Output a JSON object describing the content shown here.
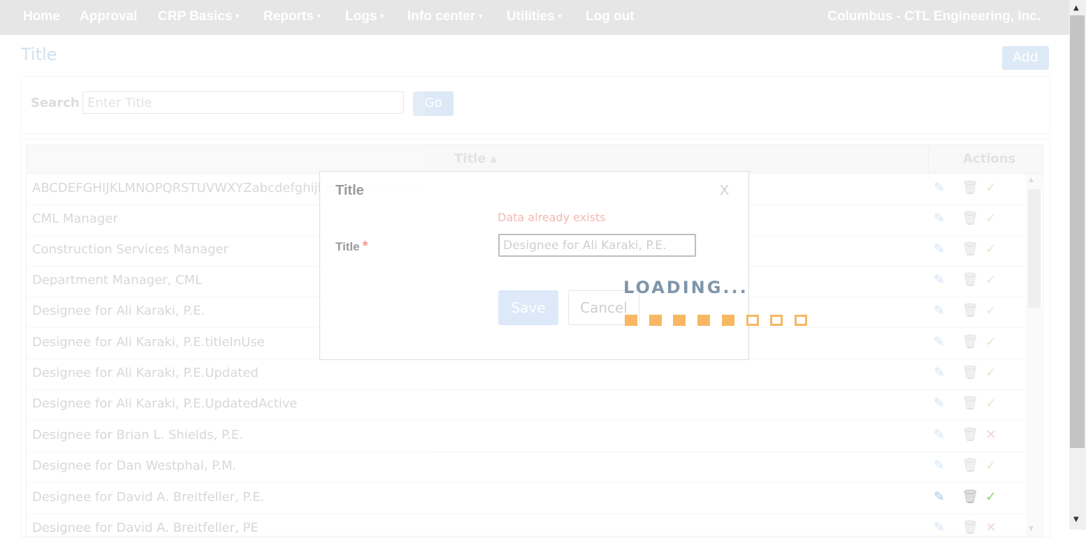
{
  "nav": {
    "items": [
      {
        "label": "Home",
        "dropdown": false
      },
      {
        "label": "Approval",
        "dropdown": false
      },
      {
        "label": "CRP Basics",
        "dropdown": true
      },
      {
        "label": "Reports",
        "dropdown": true
      },
      {
        "label": "Logs",
        "dropdown": true
      },
      {
        "label": "Info center",
        "dropdown": true
      },
      {
        "label": "Utilities",
        "dropdown": true
      },
      {
        "label": "Log out",
        "dropdown": false
      }
    ],
    "caret": "▾",
    "location": "Columbus  -  CTL Engineering, Inc."
  },
  "page": {
    "title": "Title",
    "add_label": "Add"
  },
  "search": {
    "label": "Search",
    "placeholder": "Enter Title",
    "value": "",
    "go_label": "Go"
  },
  "table": {
    "columns": {
      "title": "Title ▴",
      "actions": "Actions"
    },
    "rows": [
      {
        "text": "ABCDEFGHIJKLMNOPQRSTUVWXYZabcdefghijklmnopqrstuvwx",
        "status": "active"
      },
      {
        "text": "CML Manager",
        "status": "active"
      },
      {
        "text": "Construction Services Manager",
        "status": "active"
      },
      {
        "text": "Department Manager, CML",
        "status": "active"
      },
      {
        "text": "Designee for Ali Karaki, P.E.",
        "status": "active"
      },
      {
        "text": "Designee for Ali Karaki, P.E.titleInUse",
        "status": "active"
      },
      {
        "text": "Designee for Ali Karaki, P.E.Updated",
        "status": "active"
      },
      {
        "text": "Designee for Ali Karaki, P.E.UpdatedActive",
        "status": "active"
      },
      {
        "text": "Designee for Brian L. Shields, P.E.",
        "status": "inactive"
      },
      {
        "text": "Designee for Dan Westphal, P.M.",
        "status": "active"
      },
      {
        "text": "Designee for David A. Breitfeller, P.E.",
        "status": "active"
      },
      {
        "text": "Designee for David A. Breitfeller, PE",
        "status": "inactive"
      }
    ],
    "icons": {
      "edit": "✎",
      "delete": "🗑",
      "active": "✓",
      "inactive": "✕"
    }
  },
  "modal": {
    "title": "Title",
    "close_label": "X",
    "error": "Data already exists",
    "field_label": "Title",
    "required_mark": "*",
    "field_value": "Designee for Ali Karaki, P.E.",
    "save_label": "Save",
    "cancel_label": "Cancel"
  },
  "loading": {
    "text": "LOADING...",
    "squares_total": 8,
    "squares_filled": 5
  },
  "colors": {
    "nav_bg": "#e6e6e6",
    "loading_orange": "#f8b762",
    "loading_text": "#7f95aa",
    "error": "#f1b9b4"
  }
}
